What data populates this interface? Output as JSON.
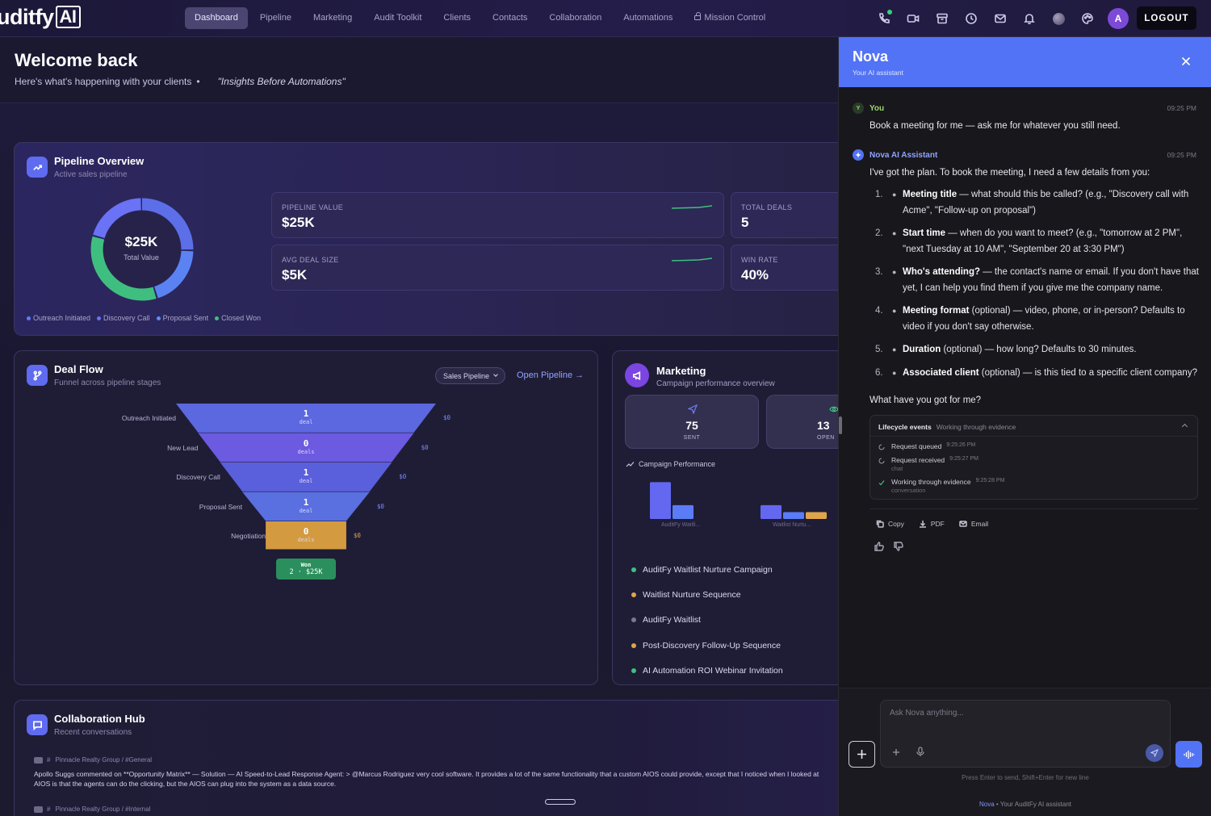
{
  "app": {
    "logo_text": "uditfy",
    "logo_ai": "AI"
  },
  "nav": [
    {
      "label": "Dashboard",
      "active": true
    },
    {
      "label": "Pipeline"
    },
    {
      "label": "Marketing"
    },
    {
      "label": "Audit Toolkit"
    },
    {
      "label": "Clients"
    },
    {
      "label": "Contacts"
    },
    {
      "label": "Collaboration"
    },
    {
      "label": "Automations"
    },
    {
      "label": "Mission Control",
      "icon": "lock-icon"
    }
  ],
  "topbar": {
    "icons": [
      "phone-icon",
      "video-icon",
      "archive-icon",
      "clock-icon",
      "mail-icon",
      "bell-icon",
      "orb-icon",
      "palette-icon"
    ],
    "avatar_initial": "A",
    "logout_label": "LOGOUT"
  },
  "welcome": {
    "title": "Welcome back",
    "subtitle": "Here's what's happening with your clients",
    "bullet": "•",
    "quote": "\"Insights Before Automations\""
  },
  "pipeline": {
    "title": "Pipeline Overview",
    "subtitle": "Active sales pipeline",
    "center_value": "$25K",
    "center_label": "Total Value",
    "legend": [
      {
        "label": "Outreach Initiated",
        "color": "#5b7cf7"
      },
      {
        "label": "Discovery Call",
        "color": "#6a72f5"
      },
      {
        "label": "Proposal Sent",
        "color": "#5b8df7"
      },
      {
        "label": "Closed Won",
        "color": "#3fbf7f"
      }
    ],
    "stats": [
      {
        "label": "PIPELINE VALUE",
        "value": "$25K"
      },
      {
        "label": "TOTAL DEALS",
        "value": "5"
      },
      {
        "label": "AVG DEAL SIZE",
        "value": "$5K"
      },
      {
        "label": "WIN RATE",
        "value": "40%"
      }
    ]
  },
  "dealflow": {
    "title": "Deal Flow",
    "subtitle": "Funnel across pipeline stages",
    "select_label": "Sales Pipeline",
    "open_link": "Open Pipeline →",
    "stages": [
      {
        "label": "Outreach Initiated",
        "count": "1",
        "unit": "deal",
        "amount": "$0",
        "color": "#5b68e0",
        "width_frac": 1.0
      },
      {
        "label": "New Lead",
        "count": "0",
        "unit": "deals",
        "amount": "$0",
        "color": "#6c5ae0",
        "width_frac": 0.83
      },
      {
        "label": "Discovery Call",
        "count": "1",
        "unit": "deal",
        "amount": "$0",
        "color": "#5a5fdc",
        "width_frac": 0.66
      },
      {
        "label": "Proposal Sent",
        "count": "1",
        "unit": "deal",
        "amount": "$0",
        "color": "#5a6fe0",
        "width_frac": 0.49
      },
      {
        "label": "Negotiation",
        "count": "0",
        "unit": "deals",
        "amount": "$0",
        "color": "#d49a40",
        "width_frac": 0.31
      }
    ],
    "won_label": "Won",
    "won_value": "2 · $25K"
  },
  "marketing": {
    "title": "Marketing",
    "subtitle": "Campaign performance overview",
    "stats": [
      {
        "value": "75",
        "label": "SENT",
        "icon": "send-icon"
      },
      {
        "value": "13",
        "label": "OPEN",
        "icon": "eye-icon"
      }
    ],
    "perf_title": "Campaign Performance",
    "bar_labels": [
      "AuditFy Waitli...",
      "Waitlist Nurtu..."
    ],
    "campaigns": [
      {
        "label": "AuditFy Waitlist Nurture Campaign",
        "color": "#3fbf7f"
      },
      {
        "label": "Waitlist Nurture Sequence",
        "color": "#e0a44a"
      },
      {
        "label": "AuditFy Waitlist",
        "color": "#7a7890"
      },
      {
        "label": "Post-Discovery Follow-Up Sequence",
        "color": "#e0a44a"
      },
      {
        "label": "AI Automation ROI Webinar Invitation",
        "color": "#3fbf7f"
      }
    ]
  },
  "chart_data": {
    "type": "bar",
    "categories": [
      "AuditFy Waitli...",
      "Waitlist Nurtu..."
    ],
    "series": [
      {
        "values": [
          32,
          12
        ],
        "color": "#6468f0"
      },
      {
        "values": [
          12,
          6
        ],
        "color": "#5b7cf7"
      },
      {
        "values": [
          0,
          6
        ],
        "color": "#e0a44a"
      }
    ],
    "title": "Campaign Performance"
  },
  "collab": {
    "title": "Collaboration Hub",
    "subtitle": "Recent conversations",
    "posts": [
      {
        "meta": "Pinnacle Realty Group / #General",
        "line1": "Apollo Suggs commented on **Opportunity Matrix** — Solution — AI Speed-to-Lead Response Agent: > @Marcus Rodriguez very cool software. It provides a lot of the same functionality that a custom AIOS could provide, except that I noticed when I looked at",
        "line2": "AIOS is that the agents can do the clicking, but the AIOS can plug into the system as a data source."
      },
      {
        "meta": "Pinnacle Realty Group / #Internal"
      }
    ]
  },
  "nova": {
    "title": "Nova",
    "subtitle": "Your AI assistant",
    "user_name": "You",
    "user_initial": "Y",
    "user_time": "09:25 PM",
    "user_message": "Book a meeting for me — ask me for whatever you still need.",
    "assistant_name": "Nova AI Assistant",
    "assistant_time": "09:25 PM",
    "assistant_intro": "I've got the plan. To book the meeting, I need a few details from you:",
    "items": [
      {
        "n": "1.",
        "bold": "Meeting title",
        "text": " — what should this be called? (e.g., \"Discovery call with Acme\", \"Follow-up on proposal\")"
      },
      {
        "n": "2.",
        "bold": "Start time",
        "text": " — when do you want to meet? (e.g., \"tomorrow at 2 PM\", \"next Tuesday at 10 AM\", \"September 20 at 3:30 PM\")"
      },
      {
        "n": "3.",
        "bold": "Who's attending?",
        "text": " — the contact's name or email. If you don't have that yet, I can help you find them if you give me the company name."
      },
      {
        "n": "4.",
        "bold": "Meeting format",
        "text": " (optional) — video, phone, or in-person? Defaults to video if you don't say otherwise."
      },
      {
        "n": "5.",
        "bold": "Duration",
        "text": " (optional) — how long? Defaults to 30 minutes."
      },
      {
        "n": "6.",
        "bold": "Associated client",
        "text": " (optional) — is this tied to a specific client company?"
      }
    ],
    "outro": "What have you got for me?",
    "lifecycle": {
      "title": "Lifecycle events",
      "status": "Working through evidence",
      "events": [
        {
          "label": "Request queued",
          "time": "9:25:26 PM",
          "sub": ""
        },
        {
          "label": "Request received",
          "time": "9:25:27 PM",
          "sub": "chat"
        },
        {
          "label": "Working through evidence",
          "time": "9:25:28 PM",
          "sub": "conversation"
        }
      ]
    },
    "actions": [
      "Copy",
      "PDF",
      "Email"
    ],
    "input_placeholder": "Ask Nova anything...",
    "hint": "Press Enter to send, Shift+Enter for new line",
    "footer_brand": "Nova",
    "footer_rest": " • Your AuditFy AI assistant"
  }
}
